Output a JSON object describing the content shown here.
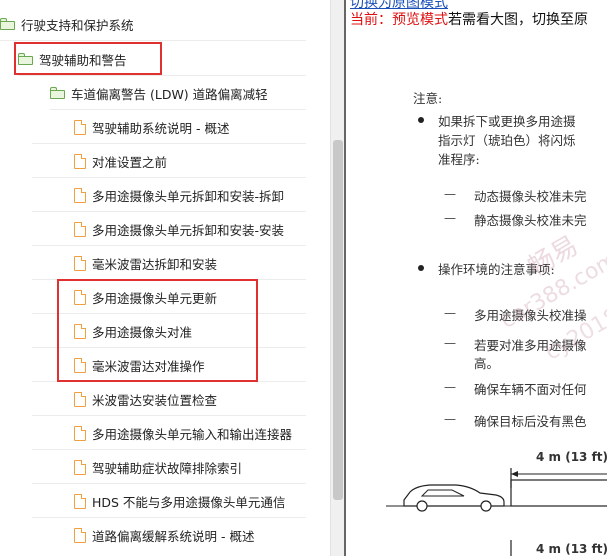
{
  "tree": {
    "items": [
      {
        "label": "行驶支持和保护系统",
        "icon": "folder-icon"
      },
      {
        "label": "驾驶辅助和警告",
        "icon": "folder-icon"
      },
      {
        "label": "车道偏离警告 (LDW) 道路偏离减轻",
        "icon": "folder-icon"
      },
      {
        "label": "驾驶辅助系统说明 - 概述",
        "icon": "document-icon"
      },
      {
        "label": "对准设置之前",
        "icon": "document-icon"
      },
      {
        "label": "多用途摄像头单元拆卸和安装-拆卸",
        "icon": "document-icon"
      },
      {
        "label": "多用途摄像头单元拆卸和安装-安装",
        "icon": "document-icon"
      },
      {
        "label": "毫米波雷达拆卸和安装",
        "icon": "document-icon"
      },
      {
        "label": "多用途摄像头单元更新",
        "icon": "document-icon"
      },
      {
        "label": "多用途摄像头对准",
        "icon": "document-icon"
      },
      {
        "label": "毫米波雷达对准操作",
        "icon": "document-icon"
      },
      {
        "label": "米波雷达安装位置检查",
        "icon": "document-icon"
      },
      {
        "label": "多用途摄像头单元输入和输出连接器",
        "icon": "document-icon"
      },
      {
        "label": "驾驶辅助症状故障排除索引",
        "icon": "document-icon"
      },
      {
        "label": "HDS 不能与多用途摄像头单元通信",
        "icon": "document-icon"
      },
      {
        "label": "道路偏离缓解系统说明 - 概述",
        "icon": "document-icon"
      }
    ]
  },
  "preview": {
    "mode_link": "切换为原图模式",
    "status_mode": "当前：预览模式",
    "status_hint": "若需看大图，切换至原",
    "notice_title": "注意:",
    "bullet1_line1": "如果拆下或更换多用途摄",
    "bullet1_line2": "指示灯（琥珀色）将闪烁",
    "bullet1_line3": "准程序:",
    "dash1": "动态摄像头校准未完",
    "dash2": "静态摄像头校准未完",
    "bullet2": "操作环境的注意事项:",
    "dash3": "多用途摄像头校准操",
    "dash4_line1": "若要对准多用途摄像",
    "dash4_line2": "高。",
    "dash5": "确保车辆不面对任何",
    "dash6": "确保目标后没有黑色",
    "dimension1": "4 m (13 ft)",
    "dimension2": "4 m (13 ft)",
    "dash_symbol": "—",
    "watermark1": "畅易",
    "watermark2": "car388.com",
    "watermark3": "cy2018"
  },
  "colors": {
    "highlight": "#e03030",
    "folder": "#6aa84f",
    "document": "#f0a040",
    "status_red": "#e01010",
    "link_blue": "#1a4fb8"
  }
}
